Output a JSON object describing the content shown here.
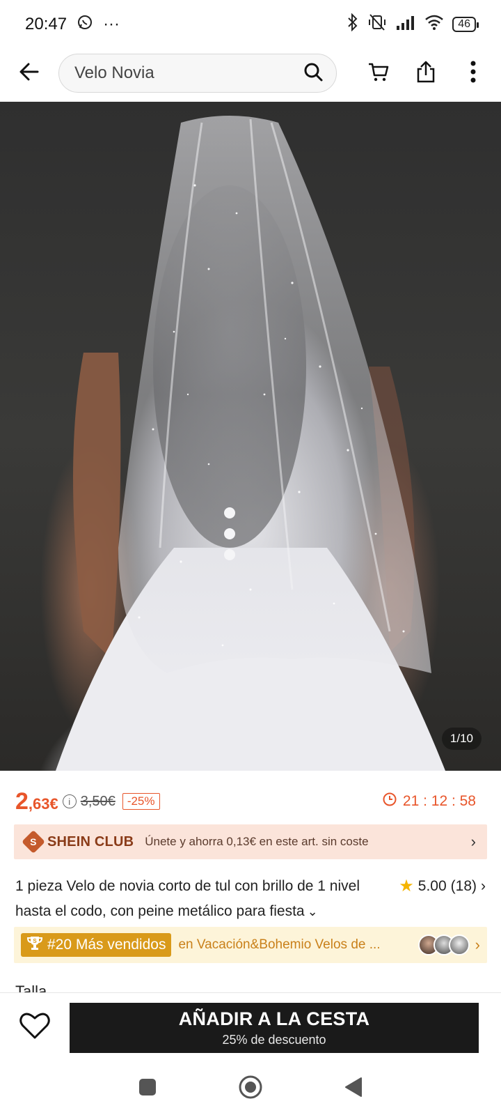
{
  "status": {
    "time": "20:47",
    "more": "···",
    "battery": "46"
  },
  "header": {
    "search_query": "Velo Novia",
    "icons": [
      "back-arrow-icon",
      "search-icon",
      "cart-icon",
      "share-icon",
      "more-vertical-icon"
    ]
  },
  "gallery": {
    "counter": "1/10"
  },
  "price": {
    "current_int": "2",
    "current_dec": ",63€",
    "original": "3,50€",
    "discount": "-25%",
    "countdown": "21 : 12 : 58",
    "accent_color": "#e8552a"
  },
  "club": {
    "logo_letter": "S",
    "name": "SHEIN CLUB",
    "text": "Únete y ahorra 0,13€ en este art. sin coste"
  },
  "product": {
    "title": "1 pieza Velo de novia corto de tul con brillo de 1 nivel hasta el codo, con peine metálico para fiesta",
    "rating": "5.00",
    "reviews": "(18)"
  },
  "bestseller": {
    "badge": "#20 Más vendidos",
    "category": "en Vacación&Bohemio Velos de ..."
  },
  "size": {
    "label": "Talla"
  },
  "cta": {
    "label": "AÑADIR A LA CESTA",
    "sub": "25% de descuento",
    "color": "#1a1a1a"
  }
}
